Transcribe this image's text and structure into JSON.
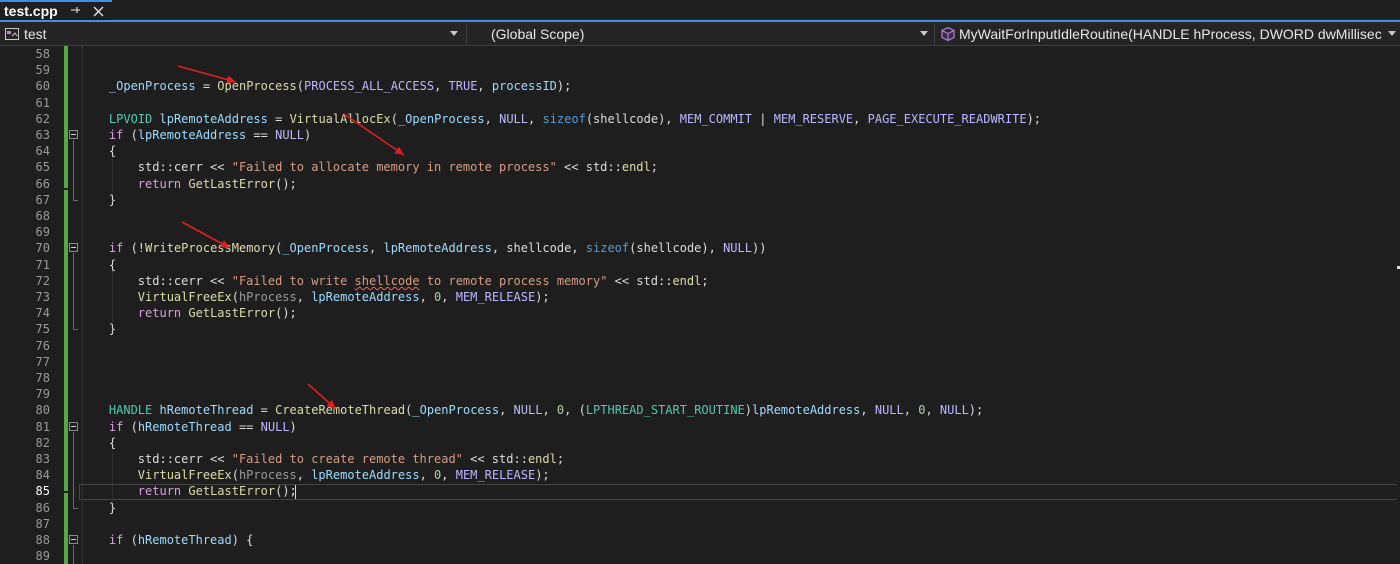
{
  "tab": {
    "title": "test.cpp",
    "pin_glyph": "⊣",
    "close_glyph": "✕"
  },
  "navbar": {
    "project": "test",
    "scope": "(Global Scope)",
    "member": "MyWaitForInputIdleRoutine(HANDLE hProcess, DWORD dwMillisec"
  },
  "editor": {
    "current_line": 85,
    "lines": [
      {
        "no": 58,
        "tokens": []
      },
      {
        "no": 59,
        "tokens": []
      },
      {
        "no": 60,
        "tokens": [
          {
            "c": "txt",
            "t": "    "
          },
          {
            "c": "var",
            "t": "_OpenProcess"
          },
          {
            "c": "txt",
            "t": " = "
          },
          {
            "c": "fn",
            "t": "OpenProcess"
          },
          {
            "c": "txt",
            "t": "("
          },
          {
            "c": "macro",
            "t": "PROCESS_ALL_ACCESS"
          },
          {
            "c": "txt",
            "t": ", "
          },
          {
            "c": "macro",
            "t": "TRUE"
          },
          {
            "c": "txt",
            "t": ", "
          },
          {
            "c": "var",
            "t": "processID"
          },
          {
            "c": "txt",
            "t": ");"
          }
        ]
      },
      {
        "no": 61,
        "tokens": []
      },
      {
        "no": 62,
        "tokens": [
          {
            "c": "txt",
            "t": "    "
          },
          {
            "c": "type",
            "t": "LPVOID"
          },
          {
            "c": "txt",
            "t": " "
          },
          {
            "c": "var",
            "t": "lpRemoteAddress"
          },
          {
            "c": "txt",
            "t": " = "
          },
          {
            "c": "fn",
            "t": "VirtualAllocEx"
          },
          {
            "c": "txt",
            "t": "("
          },
          {
            "c": "var",
            "t": "_OpenProcess"
          },
          {
            "c": "txt",
            "t": ", "
          },
          {
            "c": "macro",
            "t": "NULL"
          },
          {
            "c": "txt",
            "t": ", "
          },
          {
            "c": "kw",
            "t": "sizeof"
          },
          {
            "c": "txt",
            "t": "(shellcode), "
          },
          {
            "c": "macro",
            "t": "MEM_COMMIT"
          },
          {
            "c": "txt",
            "t": " | "
          },
          {
            "c": "macro",
            "t": "MEM_RESERVE"
          },
          {
            "c": "txt",
            "t": ", "
          },
          {
            "c": "macro",
            "t": "PAGE_EXECUTE_READWRITE"
          },
          {
            "c": "txt",
            "t": ");"
          }
        ]
      },
      {
        "no": 63,
        "tokens": [
          {
            "c": "txt",
            "t": "    "
          },
          {
            "c": "ctl",
            "t": "if"
          },
          {
            "c": "txt",
            "t": " ("
          },
          {
            "c": "var",
            "t": "lpRemoteAddress"
          },
          {
            "c": "txt",
            "t": " == "
          },
          {
            "c": "macro",
            "t": "NULL"
          },
          {
            "c": "txt",
            "t": ")"
          }
        ]
      },
      {
        "no": 64,
        "tokens": [
          {
            "c": "txt",
            "t": "    {"
          }
        ]
      },
      {
        "no": 65,
        "tokens": [
          {
            "c": "txt",
            "t": "        std::cerr << "
          },
          {
            "c": "str",
            "t": "\"Failed to allocate memory in remote process\""
          },
          {
            "c": "txt",
            "t": " << std::"
          },
          {
            "c": "fn",
            "t": "endl"
          },
          {
            "c": "txt",
            "t": ";"
          }
        ]
      },
      {
        "no": 66,
        "tokens": [
          {
            "c": "txt",
            "t": "        "
          },
          {
            "c": "ctl",
            "t": "return"
          },
          {
            "c": "txt",
            "t": " "
          },
          {
            "c": "fn",
            "t": "GetLastError"
          },
          {
            "c": "txt",
            "t": "();"
          }
        ]
      },
      {
        "no": 67,
        "tokens": [
          {
            "c": "txt",
            "t": "    }"
          }
        ]
      },
      {
        "no": 68,
        "tokens": []
      },
      {
        "no": 69,
        "tokens": []
      },
      {
        "no": 70,
        "tokens": [
          {
            "c": "txt",
            "t": "    "
          },
          {
            "c": "ctl",
            "t": "if"
          },
          {
            "c": "txt",
            "t": " (!"
          },
          {
            "c": "fn",
            "t": "WriteProcessMemory"
          },
          {
            "c": "txt",
            "t": "("
          },
          {
            "c": "var",
            "t": "_OpenProcess"
          },
          {
            "c": "txt",
            "t": ", "
          },
          {
            "c": "var",
            "t": "lpRemoteAddress"
          },
          {
            "c": "txt",
            "t": ", shellcode, "
          },
          {
            "c": "kw",
            "t": "sizeof"
          },
          {
            "c": "txt",
            "t": "(shellcode), "
          },
          {
            "c": "macro",
            "t": "NULL"
          },
          {
            "c": "txt",
            "t": "))"
          }
        ]
      },
      {
        "no": 71,
        "tokens": [
          {
            "c": "txt",
            "t": "    {"
          }
        ]
      },
      {
        "no": 72,
        "tokens": [
          {
            "c": "txt",
            "t": "        std::cerr << "
          },
          {
            "c": "str",
            "t": "\"Failed to write "
          },
          {
            "c": "str squiggle",
            "t": "shellcode"
          },
          {
            "c": "str",
            "t": " to remote process memory\""
          },
          {
            "c": "txt",
            "t": " << std::"
          },
          {
            "c": "fn",
            "t": "endl"
          },
          {
            "c": "txt",
            "t": ";"
          }
        ]
      },
      {
        "no": 73,
        "tokens": [
          {
            "c": "txt",
            "t": "        "
          },
          {
            "c": "fn",
            "t": "VirtualFreeEx"
          },
          {
            "c": "txt",
            "t": "("
          },
          {
            "c": "param",
            "t": "hProcess"
          },
          {
            "c": "txt",
            "t": ", "
          },
          {
            "c": "var",
            "t": "lpRemoteAddress"
          },
          {
            "c": "txt",
            "t": ", "
          },
          {
            "c": "num",
            "t": "0"
          },
          {
            "c": "txt",
            "t": ", "
          },
          {
            "c": "macro",
            "t": "MEM_RELEASE"
          },
          {
            "c": "txt",
            "t": ");"
          }
        ]
      },
      {
        "no": 74,
        "tokens": [
          {
            "c": "txt",
            "t": "        "
          },
          {
            "c": "ctl",
            "t": "return"
          },
          {
            "c": "txt",
            "t": " "
          },
          {
            "c": "fn",
            "t": "GetLastError"
          },
          {
            "c": "txt",
            "t": "();"
          }
        ]
      },
      {
        "no": 75,
        "tokens": [
          {
            "c": "txt",
            "t": "    }"
          }
        ]
      },
      {
        "no": 76,
        "tokens": []
      },
      {
        "no": 77,
        "tokens": []
      },
      {
        "no": 78,
        "tokens": []
      },
      {
        "no": 79,
        "tokens": []
      },
      {
        "no": 80,
        "tokens": [
          {
            "c": "txt",
            "t": "    "
          },
          {
            "c": "type",
            "t": "HANDLE"
          },
          {
            "c": "txt",
            "t": " "
          },
          {
            "c": "var",
            "t": "hRemoteThread"
          },
          {
            "c": "txt",
            "t": " = "
          },
          {
            "c": "fn",
            "t": "CreateRemoteThread"
          },
          {
            "c": "txt",
            "t": "("
          },
          {
            "c": "var",
            "t": "_OpenProcess"
          },
          {
            "c": "txt",
            "t": ", "
          },
          {
            "c": "macro",
            "t": "NULL"
          },
          {
            "c": "txt",
            "t": ", "
          },
          {
            "c": "num",
            "t": "0"
          },
          {
            "c": "txt",
            "t": ", ("
          },
          {
            "c": "type",
            "t": "LPTHREAD_START_ROUTINE"
          },
          {
            "c": "txt",
            "t": ")"
          },
          {
            "c": "var",
            "t": "lpRemoteAddress"
          },
          {
            "c": "txt",
            "t": ", "
          },
          {
            "c": "macro",
            "t": "NULL"
          },
          {
            "c": "txt",
            "t": ", "
          },
          {
            "c": "num",
            "t": "0"
          },
          {
            "c": "txt",
            "t": ", "
          },
          {
            "c": "macro",
            "t": "NULL"
          },
          {
            "c": "txt",
            "t": ");"
          }
        ]
      },
      {
        "no": 81,
        "tokens": [
          {
            "c": "txt",
            "t": "    "
          },
          {
            "c": "ctl",
            "t": "if"
          },
          {
            "c": "txt",
            "t": " ("
          },
          {
            "c": "var",
            "t": "hRemoteThread"
          },
          {
            "c": "txt",
            "t": " == "
          },
          {
            "c": "macro",
            "t": "NULL"
          },
          {
            "c": "txt",
            "t": ")"
          }
        ]
      },
      {
        "no": 82,
        "tokens": [
          {
            "c": "txt",
            "t": "    {"
          }
        ]
      },
      {
        "no": 83,
        "tokens": [
          {
            "c": "txt",
            "t": "        std::cerr << "
          },
          {
            "c": "str",
            "t": "\"Failed to create remote thread\""
          },
          {
            "c": "txt",
            "t": " << std::"
          },
          {
            "c": "fn",
            "t": "endl"
          },
          {
            "c": "txt",
            "t": ";"
          }
        ]
      },
      {
        "no": 84,
        "tokens": [
          {
            "c": "txt",
            "t": "        "
          },
          {
            "c": "fn",
            "t": "VirtualFreeEx"
          },
          {
            "c": "txt",
            "t": "("
          },
          {
            "c": "param",
            "t": "hProcess"
          },
          {
            "c": "txt",
            "t": ", "
          },
          {
            "c": "var",
            "t": "lpRemoteAddress"
          },
          {
            "c": "txt",
            "t": ", "
          },
          {
            "c": "num",
            "t": "0"
          },
          {
            "c": "txt",
            "t": ", "
          },
          {
            "c": "macro",
            "t": "MEM_RELEASE"
          },
          {
            "c": "txt",
            "t": ");"
          }
        ]
      },
      {
        "no": 85,
        "tokens": [
          {
            "c": "txt",
            "t": "        "
          },
          {
            "c": "ctl",
            "t": "return"
          },
          {
            "c": "txt",
            "t": " "
          },
          {
            "c": "fn",
            "t": "GetLastError"
          },
          {
            "c": "txt",
            "t": "();"
          }
        ]
      },
      {
        "no": 86,
        "tokens": [
          {
            "c": "txt",
            "t": "    }"
          }
        ]
      },
      {
        "no": 87,
        "tokens": []
      },
      {
        "no": 88,
        "tokens": [
          {
            "c": "txt",
            "t": "    "
          },
          {
            "c": "ctl",
            "t": "if"
          },
          {
            "c": "txt",
            "t": " ("
          },
          {
            "c": "var",
            "t": "hRemoteThread"
          },
          {
            "c": "txt",
            "t": ") {"
          }
        ]
      },
      {
        "no": 89,
        "tokens": []
      }
    ]
  },
  "colors": {
    "background": "#1e1e1e",
    "function": "#dcdcaa",
    "variable": "#9cdcfe",
    "macro": "#beb7ff",
    "type": "#4ec9b0",
    "keyword": "#569cd6",
    "control": "#d8a0df",
    "string": "#d69d85",
    "change_bar": "#57a64a",
    "annotation_arrow": "#e02020"
  }
}
